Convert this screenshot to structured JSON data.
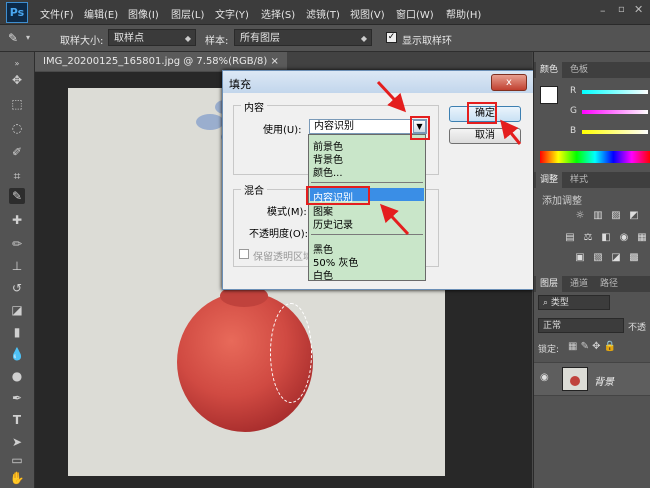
{
  "app": {
    "logo": "Ps"
  },
  "menu": [
    "文件(F)",
    "编辑(E)",
    "图像(I)",
    "图层(L)",
    "文字(Y)",
    "选择(S)",
    "滤镜(T)",
    "视图(V)",
    "窗口(W)",
    "帮助(H)"
  ],
  "options": {
    "sample_size_label": "取样大小:",
    "sample_size_value": "取样点",
    "sample_label": "样本:",
    "sample_value": "所有图层",
    "show_ring_label": "显示取样环"
  },
  "document": {
    "tab_title": "IMG_20200125_165801.jpg @ 7.58%(RGB/8)"
  },
  "dialog": {
    "title": "填充",
    "close_label": "x",
    "content_group": "内容",
    "use_label": "使用(U):",
    "use_value": "内容识别",
    "blend_group": "混合",
    "mode_label": "模式(M):",
    "opacity_label": "不透明度(O):",
    "preserve_label": "保留透明区域",
    "ok_label": "确定",
    "cancel_label": "取消"
  },
  "dropdown": {
    "group1": [
      "前景色",
      "背景色",
      "颜色..."
    ],
    "highlighted": "内容识别",
    "group2": [
      "图案",
      "历史记录"
    ],
    "group3": [
      "黑色",
      "50% 灰色",
      "白色"
    ]
  },
  "panels": {
    "color_tabs": [
      "颜色",
      "色板"
    ],
    "rgb_labels": [
      "R",
      "G",
      "B"
    ],
    "adjust_tabs": [
      "调整",
      "样式"
    ],
    "adjust_title": "添加调整",
    "layers_tabs": [
      "图层",
      "通道",
      "路径"
    ],
    "kind_label": "类型",
    "blend_mode": "正常",
    "opacity_short": "不透",
    "lock_label": "锁定:",
    "layer_name": "背景"
  },
  "colors": {
    "accent": "#3a8ee6",
    "annotation": "#e41e1e",
    "dropdown_bg": "#c9e6c9"
  }
}
